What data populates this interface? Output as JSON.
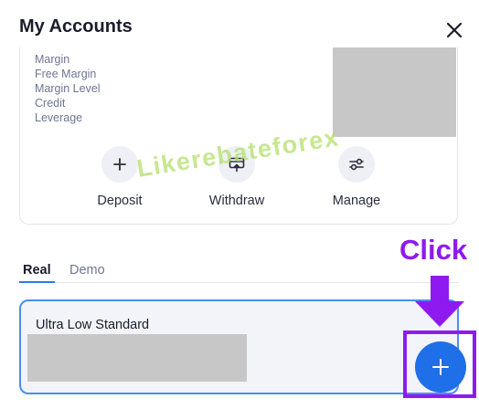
{
  "header": {
    "title": "My Accounts",
    "close_icon": "close-icon"
  },
  "account_summary": {
    "labels": [
      "Margin",
      "Free Margin",
      "Margin Level",
      "Credit",
      "Leverage"
    ],
    "actions": [
      {
        "label": "Deposit",
        "icon": "plus-icon"
      },
      {
        "label": "Withdraw",
        "icon": "withdraw-icon"
      },
      {
        "label": "Manage",
        "icon": "sliders-icon"
      }
    ]
  },
  "watermark": "Likerebateforex",
  "tabs": [
    {
      "label": "Real",
      "active": true
    },
    {
      "label": "Demo",
      "active": false
    }
  ],
  "account": {
    "name": "Ultra Low Standard"
  },
  "annotation": {
    "text": "Click",
    "color": "#8f1af0"
  },
  "colors": {
    "accent": "#1f6fe8",
    "tab_underline": "#2d7ae8",
    "card_border": "#4b8ef0"
  }
}
